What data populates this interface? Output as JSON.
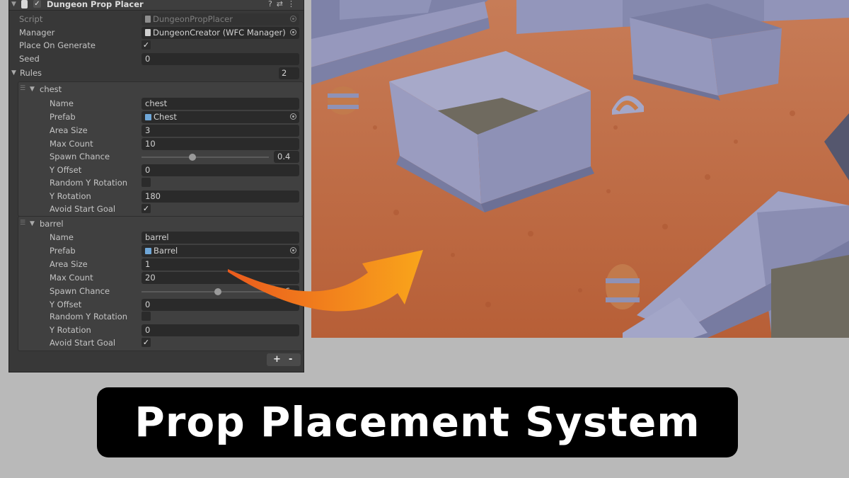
{
  "component": {
    "title": "Dungeon Prop Placer",
    "script": "DungeonPropPlacer",
    "manager": "DungeonCreator (WFC Manager)",
    "place_on_generate": true,
    "seed": "0",
    "rules_count": "2"
  },
  "labels": {
    "script": "Script",
    "manager": "Manager",
    "place_on_generate": "Place On Generate",
    "seed": "Seed",
    "rules": "Rules",
    "name": "Name",
    "prefab": "Prefab",
    "area_size": "Area Size",
    "max_count": "Max Count",
    "spawn_chance": "Spawn Chance",
    "y_offset": "Y Offset",
    "random_y_rotation": "Random Y Rotation",
    "y_rotation": "Y Rotation",
    "avoid_start_goal": "Avoid Start Goal"
  },
  "rules": [
    {
      "header": "chest",
      "name": "chest",
      "prefab": "Chest",
      "area_size": "3",
      "max_count": "10",
      "spawn_chance": "0.4",
      "spawn_chance_fraction": 0.4,
      "y_offset": "0",
      "random_y_rotation": false,
      "y_rotation": "180",
      "avoid_start_goal": true
    },
    {
      "header": "barrel",
      "name": "barrel",
      "prefab": "Barrel",
      "area_size": "1",
      "max_count": "20",
      "spawn_chance": "0.6",
      "spawn_chance_fraction": 0.6,
      "y_offset": "0",
      "random_y_rotation": false,
      "y_rotation": "0",
      "avoid_start_goal": true
    }
  ],
  "footer": {
    "add": "+",
    "remove": "-"
  },
  "banner": {
    "text": "Prop Placement System"
  },
  "colors": {
    "inspector_bg": "#383838",
    "field_bg": "#2a2a2a",
    "floor": "#c0663d",
    "wall": "#8c8fb4",
    "arrow_start": "#ea5b1d",
    "arrow_end": "#f9a51b",
    "banner_bg": "#000000"
  }
}
